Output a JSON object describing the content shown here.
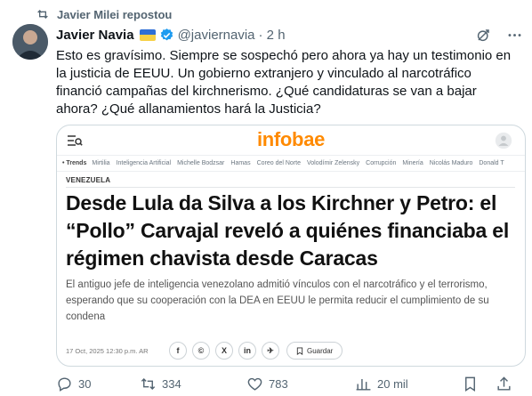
{
  "repost": {
    "label": "Javier Milei repostou",
    "icon": "repost-icon"
  },
  "author": {
    "name": "Javier Navia",
    "handle": "@javiernavia",
    "time": "· 2 h",
    "flag_colors": [
      "#2f6fd6",
      "#f7d046"
    ],
    "verified_color": "#1d9bf0"
  },
  "tweet": {
    "text": "Esto es gravísimo. Siempre se sospechó pero ahora ya hay un testimonio en\nla justicia de EEUU. Un gobierno extranjero y vinculado al narcotráfico\nfinanció campañas del kirchnerismo. ¿Qué candidaturas se van a bajar\nahora? ¿Qué allanamientos hará la Justicia?"
  },
  "card": {
    "logo": "infobae",
    "logo_color": "#ff8a00",
    "trends_lead": "• Trends",
    "trends": [
      "Mirtilia",
      "Inteligencia Artificial",
      "Michelle Bodzsar",
      "Hamas",
      "Coreo del Norte",
      "Volodímir Zelensky",
      "Corrupción",
      "Minería",
      "Nicolás Maduro",
      "Donald T"
    ],
    "section": "VENEZUELA",
    "headline": "Desde Lula da Silva a los Kirchner y Petro: el “Pollo” Carvajal reveló a quiénes financiaba el régimen chavista desde Caracas",
    "summary": "El antiguo jefe de inteligencia venezolano admitió vínculos con el narcotráfico y el terrorismo, esperando que su cooperación con la DEA en EEUU le permita reducir el cumplimiento de su condena",
    "date": "17 Oct, 2025 12:30 p.m. AR",
    "share_labels": [
      "f",
      "©",
      "X",
      "in",
      "✈"
    ],
    "save_label": "Guardar"
  },
  "actions": {
    "replies": "30",
    "reposts": "334",
    "likes": "783",
    "views": "20 mil"
  }
}
